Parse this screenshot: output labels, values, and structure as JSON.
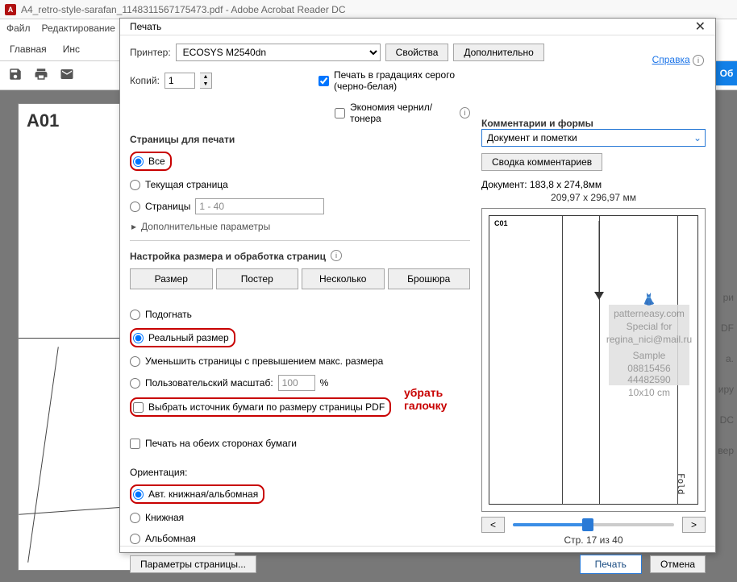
{
  "app": {
    "title": "A4_retro-style-sarafan_1148311567175473.pdf - Adobe Acrobat Reader DC",
    "menu": {
      "file": "Файл",
      "edit": "Редактирование"
    },
    "tabs": {
      "home": "Главная",
      "tools_partial": "Инс"
    },
    "side_button": "Об"
  },
  "document": {
    "page_label": "A01"
  },
  "dialog": {
    "title": "Печать",
    "printer_label": "Принтер:",
    "printer_value": "ECOSYS M2540dn",
    "properties_btn": "Свойства",
    "advanced_btn": "Дополнительно",
    "help_link": "Справка",
    "copies_label": "Копий:",
    "copies_value": "1",
    "grayscale": "Печать в градациях серого (черно-белая)",
    "inksave": "Экономия чернил/тонера",
    "pages_section": "Страницы для печати",
    "radio_all": "Все",
    "radio_current": "Текущая страница",
    "radio_range": "Страницы",
    "range_value": "1 - 40",
    "more_options": "Дополнительные параметры",
    "sizing_section": "Настройка размера и обработка страниц",
    "tab_size": "Размер",
    "tab_poster": "Постер",
    "tab_multiple": "Несколько",
    "tab_booklet": "Брошюра",
    "radio_fit": "Подогнать",
    "radio_actual": "Реальный размер",
    "radio_shrink": "Уменьшить страницы с превышением макс. размера",
    "radio_custom": "Пользовательский масштаб:",
    "custom_value": "100",
    "percent": "%",
    "paper_source": "Выбрать источник бумаги по размеру страницы PDF",
    "duplex": "Печать на обеих сторонах бумаги",
    "orientation_label": "Ориентация:",
    "orient_auto": "Авт. книжная/альбомная",
    "orient_portrait": "Книжная",
    "orient_landscape": "Альбомная",
    "page_setup_btn": "Параметры страницы...",
    "print_btn": "Печать",
    "cancel_btn": "Отмена",
    "comments_section": "Комментарии и формы",
    "comments_select": "Документ и пометки",
    "summary_btn": "Сводка комментариев",
    "doc_size": "Документ: 183,8 x 274,8мм",
    "paper_size": "209,97 x 296,97 мм",
    "prev": "<",
    "next": ">",
    "page_of": "Стр. 17 из 40",
    "preview_label": "C01",
    "fold": "Fold"
  },
  "annotations": {
    "remove_check_1": "убрать",
    "remove_check_2": "галочку"
  },
  "bg": {
    "s1": "ри",
    "s2": "DF",
    "s3": "а.",
    "s4": "иру",
    "s5": "DC",
    "s6": "е вер"
  }
}
